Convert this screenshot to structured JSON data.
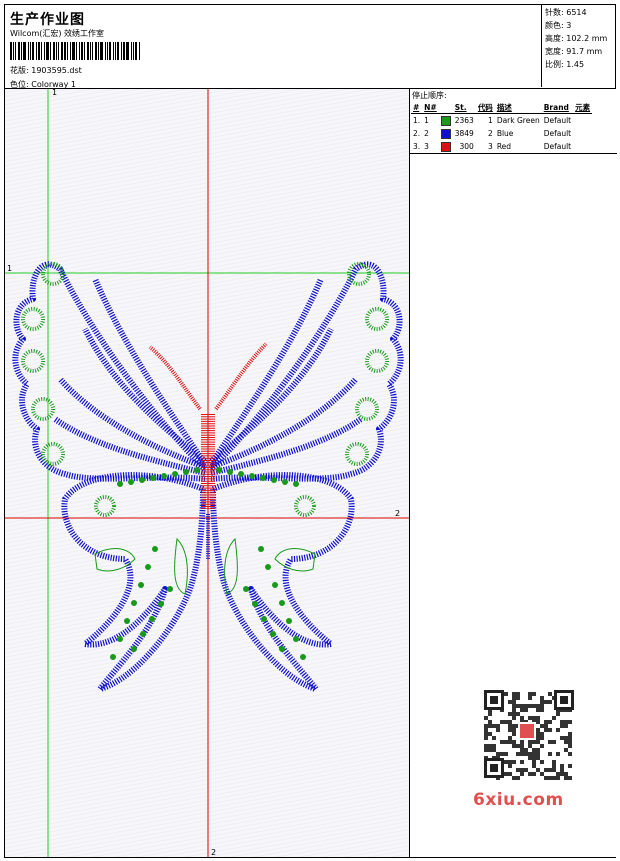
{
  "header": {
    "title": "生产作业图",
    "subtitle": "Wilcom(汇宏) 效绣工作室",
    "design_label": "花版:",
    "design_value": "1903595.dst",
    "colorway_label": "色位:",
    "colorway_value": "Colorway 1"
  },
  "stats": {
    "stitches_label": "针数:",
    "stitches_value": "6514",
    "colors_label": "颜色:",
    "colors_value": "3",
    "height_label": "高度:",
    "height_value": "102.2 mm",
    "width_label": "宽度:",
    "width_value": "91.7 mm",
    "scale_label": "比例:",
    "scale_value": "1.45"
  },
  "stop_sequence": {
    "title": "停止顺序:",
    "columns": [
      "#",
      "N#",
      "St.",
      "代码",
      "描述",
      "Brand",
      "元素"
    ],
    "rows": [
      {
        "seq": "1.",
        "n": "1",
        "color": "#1a9a1a",
        "stitches": "2363",
        "code": "1",
        "desc": "Dark Green",
        "brand": "Default"
      },
      {
        "seq": "2.",
        "n": "2",
        "color": "#1010d0",
        "stitches": "3849",
        "code": "2",
        "desc": "Blue",
        "brand": "Default"
      },
      {
        "seq": "3.",
        "n": "3",
        "color": "#e01010",
        "stitches": "300",
        "code": "3",
        "desc": "Red",
        "brand": "Default"
      }
    ]
  },
  "guides": {
    "v_green_top": "1",
    "h_green_left": "1",
    "h_red_right": "2",
    "v_red_bottom": "2"
  },
  "watermark": "6xiu.com",
  "colors": {
    "green": "#1a9a1a",
    "blue": "#1010d0",
    "red": "#e01010",
    "guide_green": "#22cc22",
    "guide_red": "#dd0000"
  }
}
